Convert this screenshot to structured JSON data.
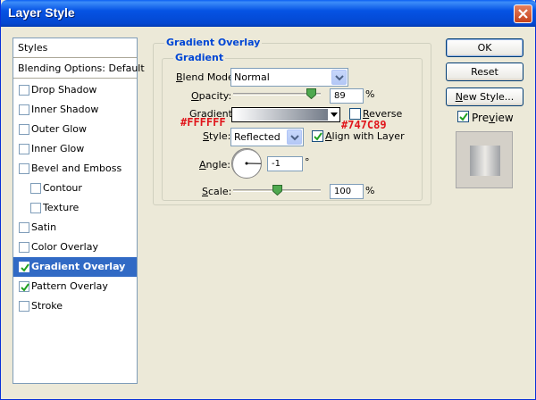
{
  "window": {
    "title": "Layer Style"
  },
  "style_list": {
    "header": "Styles",
    "blending": "Blending Options: Default",
    "items": [
      {
        "label": "Drop Shadow",
        "checked": false
      },
      {
        "label": "Inner Shadow",
        "checked": false
      },
      {
        "label": "Outer Glow",
        "checked": false
      },
      {
        "label": "Inner Glow",
        "checked": false
      },
      {
        "label": "Bevel and Emboss",
        "checked": false
      },
      {
        "label": "Contour",
        "checked": false
      },
      {
        "label": "Texture",
        "checked": false
      },
      {
        "label": "Satin",
        "checked": false
      },
      {
        "label": "Color Overlay",
        "checked": false
      },
      {
        "label": "Gradient Overlay",
        "checked": true,
        "selected": true
      },
      {
        "label": "Pattern Overlay",
        "checked": true
      },
      {
        "label": "Stroke",
        "checked": false
      }
    ]
  },
  "panel": {
    "group_title": "Gradient Overlay",
    "subgroup_title": "Gradient",
    "blend_mode": {
      "label_pre": "",
      "label_u": "B",
      "label_post": "lend Mode:",
      "value": "Normal"
    },
    "opacity": {
      "label_pre": "",
      "label_u": "O",
      "label_post": "pacity:",
      "value": "89",
      "unit": "%",
      "level": 0.89
    },
    "gradient": {
      "label": "Gradient:",
      "start_color": "#FFFFFF",
      "end_color": "#747C89"
    },
    "reverse": {
      "label_pre": "",
      "label_u": "R",
      "label_post": "everse",
      "checked": false
    },
    "style": {
      "label_pre": "",
      "label_u": "S",
      "label_post": "tyle:",
      "value": "Reflected"
    },
    "align": {
      "label_pre": "",
      "label_u": "A",
      "label_post": "lign with Layer",
      "checked": true
    },
    "angle": {
      "label_pre": "",
      "label_u": "A",
      "label_post": "ngle:",
      "value": "-1",
      "unit": "°"
    },
    "scale": {
      "label_pre": "",
      "label_u": "S",
      "label_post": "cale:",
      "value": "100",
      "unit": "%",
      "level": 0.5
    },
    "annotations": {
      "white": "#FFFFFF",
      "gray": "#747C89"
    }
  },
  "buttons": {
    "ok": "OK",
    "reset": "Reset",
    "new_style_u": "N",
    "new_style_rest": "ew Style...",
    "preview_pre": "Pre",
    "preview_u": "v",
    "preview_post": "iew",
    "preview_checked": true
  },
  "colors": {
    "title_bar": "#0553e4",
    "selection": "#316ac5",
    "group_title": "#0046d5",
    "annotation": "#e0151b"
  }
}
